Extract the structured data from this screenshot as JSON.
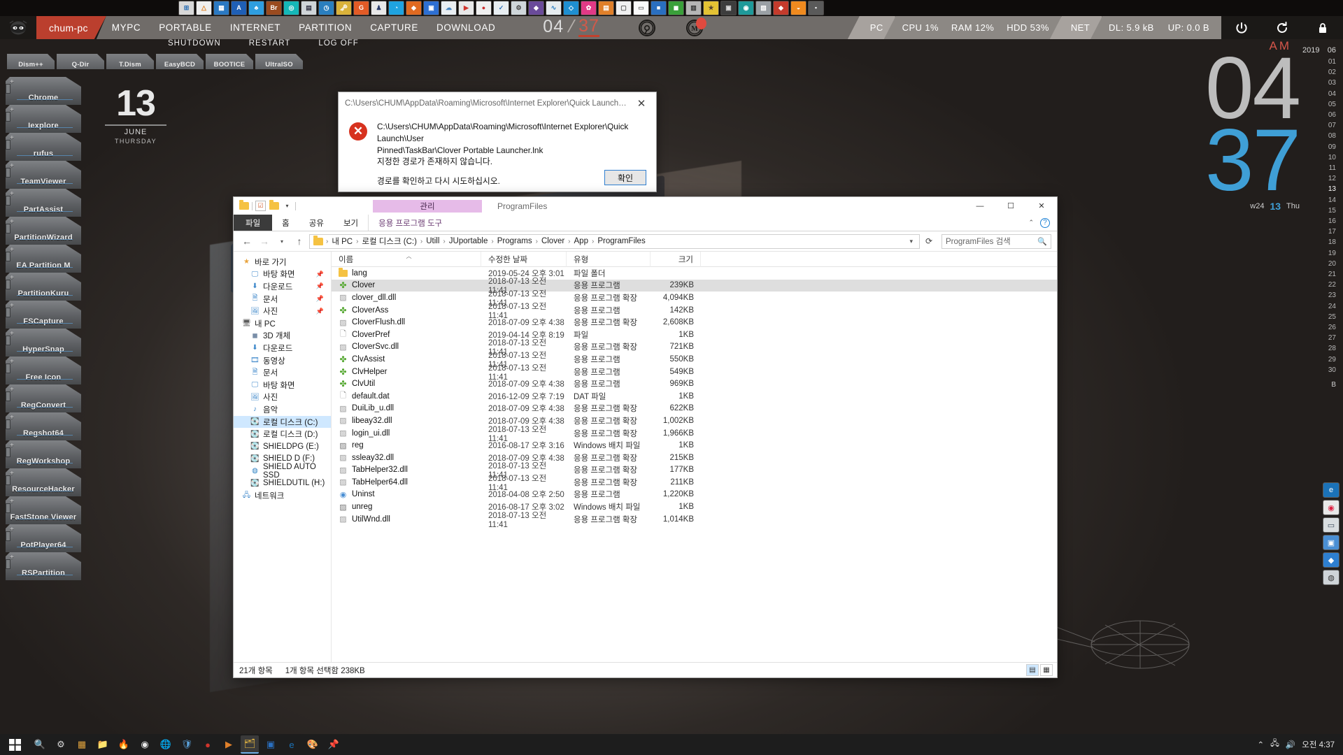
{
  "topbar": {
    "pc_name": "chum-pc",
    "menus": [
      "MYPC",
      "PORTABLE",
      "INTERNET",
      "PARTITION",
      "CAPTURE",
      "DOWNLOAD"
    ],
    "clock_hour": "04",
    "clock_minute": "37",
    "chrome_icon": "chrome-icon",
    "m_icon": "M",
    "sysinfo": {
      "pc_label": "PC",
      "cpu": "CPU 1%",
      "ram": "RAM 12%",
      "hdd": "HDD 53%",
      "net_label": "NET",
      "dl": "DL: 5.9 kB",
      "up": "UP: 0.0 B"
    },
    "right_buttons": [
      "power-icon",
      "restart-icon",
      "lock-icon"
    ],
    "accent_red": "#bb3f2e",
    "accent_blue": "#3f9fd6"
  },
  "power_row": [
    "SHUTDOWN",
    "RESTART",
    "LOG OFF"
  ],
  "tool_tabs": [
    "Dism++",
    "Q-Dir",
    "T.Dism",
    "EasyBCD",
    "BOOTICE",
    "UltraISO"
  ],
  "launchers": [
    "Chrome",
    "Iexplore",
    "rufus",
    "TeamViewer",
    "PartAssist",
    "PartitionWizard",
    "EA Partition M",
    "PartitionKuru",
    "FSCapture",
    "HyperSnap",
    "Free Icon",
    "RegConvert",
    "Regshot64",
    "RegWorkshop",
    "ResourceHacker",
    "FastStone Viewer",
    "PotPlayer64",
    "RSPartition"
  ],
  "date_widget": {
    "day": "13",
    "month": "JUNE",
    "weekday": "THURSDAY"
  },
  "right_clock": {
    "meridiem": "AM",
    "hour": "04",
    "minute": "37",
    "week": "w24",
    "day": "13",
    "weekday_short": "Thu"
  },
  "calendar": {
    "year": "2019",
    "month": "06",
    "days": [
      "01",
      "02",
      "03",
      "04",
      "05",
      "06",
      "07",
      "08",
      "09",
      "10",
      "11",
      "12",
      "13",
      "14",
      "15",
      "16",
      "17",
      "18",
      "19",
      "20",
      "21",
      "22",
      "23",
      "24",
      "25",
      "26",
      "27",
      "28",
      "29",
      "30"
    ],
    "selected_day": "13",
    "footer": "B"
  },
  "error_dialog": {
    "titlebar": "C:\\Users\\CHUM\\AppData\\Roaming\\Microsoft\\Internet Explorer\\Quick Launch\\User Pinn...",
    "close_icon": "close-icon",
    "error_icon": "error-icon",
    "line1": "C:\\Users\\CHUM\\AppData\\Roaming\\Microsoft\\Internet Explorer\\Quick Launch\\User",
    "line2": "Pinned\\TaskBar\\Clover Portable Launcher.lnk",
    "line3": "지정한 경로가 존재하지 않습니다.",
    "line4": "경로를 확인하고 다시 시도하십시오.",
    "ok_button": "확인"
  },
  "explorer": {
    "window_title": "ProgramFiles",
    "management_tab": "관리",
    "quick_access_toolbar": [
      "folder-icon",
      "properties-icon",
      "new-folder-icon",
      "dropdown-icon"
    ],
    "ribbon_tabs": [
      "파일",
      "홈",
      "공유",
      "보기"
    ],
    "app_tools_tab": "응용 프로그램 도구",
    "window_buttons": [
      "minimize-icon",
      "maximize-icon",
      "close-icon"
    ],
    "help_icon": "help-icon",
    "nav_buttons": [
      "back-icon",
      "forward-icon",
      "recent-icon",
      "up-icon"
    ],
    "breadcrumbs": [
      "내 PC",
      "로컬 디스크 (C:)",
      "Utill",
      "JUportable",
      "Programs",
      "Clover",
      "App",
      "ProgramFiles"
    ],
    "refresh_icon": "refresh-icon",
    "search_placeholder": "ProgramFiles 검색",
    "search_icon": "search-icon",
    "nav_pane": [
      {
        "label": "바로 가기",
        "icon": "star-icon",
        "level": 0,
        "pin": false
      },
      {
        "label": "바탕 화면",
        "icon": "desktop-icon",
        "level": 1,
        "pin": true
      },
      {
        "label": "다운로드",
        "icon": "download-icon",
        "level": 1,
        "pin": true
      },
      {
        "label": "문서",
        "icon": "document-icon",
        "level": 1,
        "pin": true
      },
      {
        "label": "사진",
        "icon": "picture-icon",
        "level": 1,
        "pin": true
      },
      {
        "label": "내 PC",
        "icon": "pc-icon",
        "level": 0,
        "pin": false
      },
      {
        "label": "3D 개체",
        "icon": "cube-icon",
        "level": 1,
        "pin": false
      },
      {
        "label": "다운로드",
        "icon": "download-icon",
        "level": 1,
        "pin": false
      },
      {
        "label": "동영상",
        "icon": "video-icon",
        "level": 1,
        "pin": false
      },
      {
        "label": "문서",
        "icon": "document-icon",
        "level": 1,
        "pin": false
      },
      {
        "label": "바탕 화면",
        "icon": "desktop-icon",
        "level": 1,
        "pin": false
      },
      {
        "label": "사진",
        "icon": "picture-icon",
        "level": 1,
        "pin": false
      },
      {
        "label": "음악",
        "icon": "music-icon",
        "level": 1,
        "pin": false
      },
      {
        "label": "로컬 디스크 (C:)",
        "icon": "drive-icon",
        "level": 1,
        "pin": false,
        "selected": true
      },
      {
        "label": "로컬 디스크 (D:)",
        "icon": "drive-icon",
        "level": 1,
        "pin": false
      },
      {
        "label": "SHIELDPG (E:)",
        "icon": "drive-icon",
        "level": 1,
        "pin": false
      },
      {
        "label": "SHIELD D (F:)",
        "icon": "drive-icon",
        "level": 1,
        "pin": false
      },
      {
        "label": "SHIELD AUTO SSD",
        "icon": "disc-icon",
        "level": 1,
        "pin": false
      },
      {
        "label": "SHIELDUTIL (H:)",
        "icon": "drive-icon",
        "level": 1,
        "pin": false
      },
      {
        "label": "네트워크",
        "icon": "network-icon",
        "level": 0,
        "pin": false
      }
    ],
    "columns": [
      "이름",
      "수정한 날짜",
      "유형",
      "크기"
    ],
    "sort_indicator": "ascending-arrow",
    "files": [
      {
        "name": "lang",
        "icon": "folder",
        "date": "2019-05-24 오후 3:01",
        "type": "파일 폴더",
        "size": "",
        "selected": false
      },
      {
        "name": "Clover",
        "icon": "clover",
        "date": "2018-07-13 오전 11:41",
        "type": "응용 프로그램",
        "size": "239KB",
        "selected": true
      },
      {
        "name": "clover_dll.dll",
        "icon": "dll",
        "date": "2018-07-13 오전 11:41",
        "type": "응용 프로그램 확장",
        "size": "4,094KB",
        "selected": false
      },
      {
        "name": "CloverAss",
        "icon": "clover",
        "date": "2018-07-13 오전 11:41",
        "type": "응용 프로그램",
        "size": "142KB",
        "selected": false
      },
      {
        "name": "CloverFlush.dll",
        "icon": "dll",
        "date": "2018-07-09 오후 4:38",
        "type": "응용 프로그램 확장",
        "size": "2,608KB",
        "selected": false
      },
      {
        "name": "CloverPref",
        "icon": "doc",
        "date": "2019-04-14 오후 8:19",
        "type": "파일",
        "size": "1KB",
        "selected": false
      },
      {
        "name": "CloverSvc.dll",
        "icon": "dll",
        "date": "2018-07-13 오전 11:41",
        "type": "응용 프로그램 확장",
        "size": "721KB",
        "selected": false
      },
      {
        "name": "ClvAssist",
        "icon": "clover",
        "date": "2018-07-13 오전 11:41",
        "type": "응용 프로그램",
        "size": "550KB",
        "selected": false
      },
      {
        "name": "ClvHelper",
        "icon": "clover",
        "date": "2018-07-13 오전 11:41",
        "type": "응용 프로그램",
        "size": "549KB",
        "selected": false
      },
      {
        "name": "ClvUtil",
        "icon": "clover",
        "date": "2018-07-09 오후 4:38",
        "type": "응용 프로그램",
        "size": "969KB",
        "selected": false
      },
      {
        "name": "default.dat",
        "icon": "doc",
        "date": "2016-12-09 오후 7:19",
        "type": "DAT 파일",
        "size": "1KB",
        "selected": false
      },
      {
        "name": "DuiLib_u.dll",
        "icon": "dll",
        "date": "2018-07-09 오후 4:38",
        "type": "응용 프로그램 확장",
        "size": "622KB",
        "selected": false
      },
      {
        "name": "libeay32.dll",
        "icon": "dll",
        "date": "2018-07-09 오후 4:38",
        "type": "응용 프로그램 확장",
        "size": "1,002KB",
        "selected": false
      },
      {
        "name": "login_ui.dll",
        "icon": "dll",
        "date": "2018-07-13 오전 11:41",
        "type": "응용 프로그램 확장",
        "size": "1,966KB",
        "selected": false
      },
      {
        "name": "reg",
        "icon": "bat",
        "date": "2016-08-17 오후 3:16",
        "type": "Windows 배치 파일",
        "size": "1KB",
        "selected": false
      },
      {
        "name": "ssleay32.dll",
        "icon": "dll",
        "date": "2018-07-09 오후 4:38",
        "type": "응용 프로그램 확장",
        "size": "215KB",
        "selected": false
      },
      {
        "name": "TabHelper32.dll",
        "icon": "dll",
        "date": "2018-07-13 오전 11:41",
        "type": "응용 프로그램 확장",
        "size": "177KB",
        "selected": false
      },
      {
        "name": "TabHelper64.dll",
        "icon": "dll",
        "date": "2018-07-13 오전 11:41",
        "type": "응용 프로그램 확장",
        "size": "211KB",
        "selected": false
      },
      {
        "name": "Uninst",
        "icon": "unin",
        "date": "2018-04-08 오후 2:50",
        "type": "응용 프로그램",
        "size": "1,220KB",
        "selected": false
      },
      {
        "name": "unreg",
        "icon": "bat",
        "date": "2016-08-17 오후 3:02",
        "type": "Windows 배치 파일",
        "size": "1KB",
        "selected": false
      },
      {
        "name": "UtilWnd.dll",
        "icon": "dll",
        "date": "2018-07-13 오전 11:41",
        "type": "응용 프로그램 확장",
        "size": "1,014KB",
        "selected": false
      }
    ],
    "status_count": "21개 항목",
    "status_selected": "1개 항목 선택함 238KB"
  },
  "taskbar": {
    "start_icon": "windows-start-icon",
    "icons": [
      "search-icon",
      "settings-icon",
      "calc-icon",
      "folder-icon",
      "flame-icon",
      "chrome-icon",
      "globe-icon",
      "shield-icon",
      "record-icon",
      "media-icon",
      "explorer-icon",
      "app-icon",
      "edge-icon",
      "paint-icon",
      "pin-icon"
    ],
    "tray_icons": [
      "chevron-up-icon",
      "network-icon",
      "volume-icon"
    ],
    "time": "오전 4:37"
  }
}
